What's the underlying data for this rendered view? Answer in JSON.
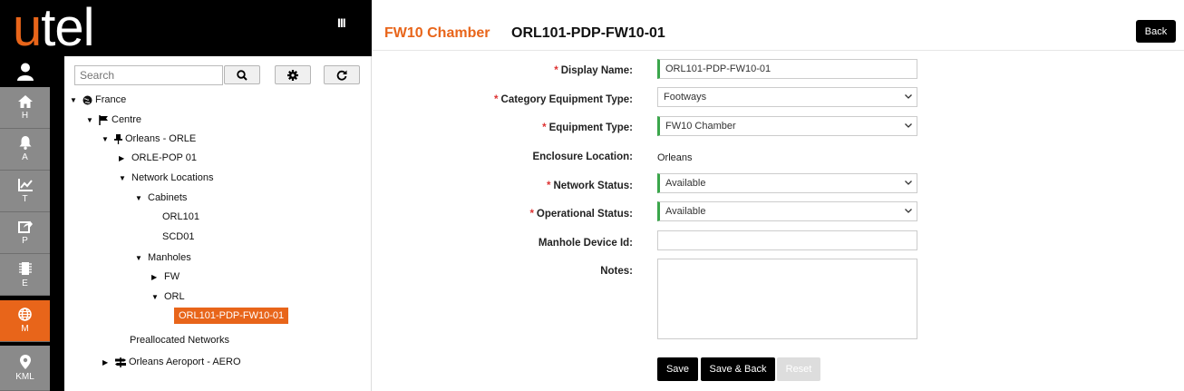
{
  "app": {
    "logo_u": "u",
    "logo_rest": "tel",
    "menu_glyph": "III"
  },
  "nav": [
    {
      "letter": "H",
      "icon": "home-icon"
    },
    {
      "letter": "A",
      "icon": "bell-icon"
    },
    {
      "letter": "T",
      "icon": "chart-icon"
    },
    {
      "letter": "P",
      "icon": "share-icon"
    },
    {
      "letter": "E",
      "icon": "chip-icon"
    },
    {
      "letter": "M",
      "icon": "globe-icon",
      "active": true
    },
    {
      "letter": "KML",
      "icon": "pin-icon"
    }
  ],
  "tree": {
    "search_placeholder": "Search",
    "nodes": {
      "france": "France",
      "centre": "Centre",
      "orleans": "Orleans - ORLE",
      "orle_pop": "ORLE-POP 01",
      "network_locations": "Network Locations",
      "cabinets": "Cabinets",
      "orl101": "ORL101",
      "scd01": "SCD01",
      "manholes": "Manholes",
      "fw": "FW",
      "orl": "ORL",
      "selected": "ORL101-PDP-FW10-01",
      "preallocated": "Preallocated Networks",
      "aeroport": "Orleans Aeroport - AERO"
    }
  },
  "header": {
    "type": "FW10 Chamber",
    "name": "ORL101-PDP-FW10-01",
    "back_label": "Back"
  },
  "form": {
    "display_name": {
      "label": "Display Name:",
      "value": "ORL101-PDP-FW10-01",
      "required": "*"
    },
    "category_type": {
      "label": "Category Equipment Type:",
      "value": "Footways",
      "required": "*"
    },
    "equipment_type": {
      "label": "Equipment Type:",
      "value": "FW10 Chamber",
      "required": "*"
    },
    "enclosure_location": {
      "label": "Enclosure Location:",
      "value": "Orleans"
    },
    "network_status": {
      "label": "Network Status:",
      "value": "Available",
      "required": "*"
    },
    "operational_status": {
      "label": "Operational Status:",
      "value": "Available",
      "required": "*"
    },
    "manhole_device_id": {
      "label": "Manhole Device Id:",
      "value": ""
    },
    "notes": {
      "label": "Notes:",
      "value": ""
    }
  },
  "actions": {
    "save": "Save",
    "save_back": "Save & Back",
    "reset": "Reset"
  },
  "colors": {
    "accent": "#e8651a",
    "valid": "#3aa64b",
    "nav_bg": "#8a8a8a"
  }
}
